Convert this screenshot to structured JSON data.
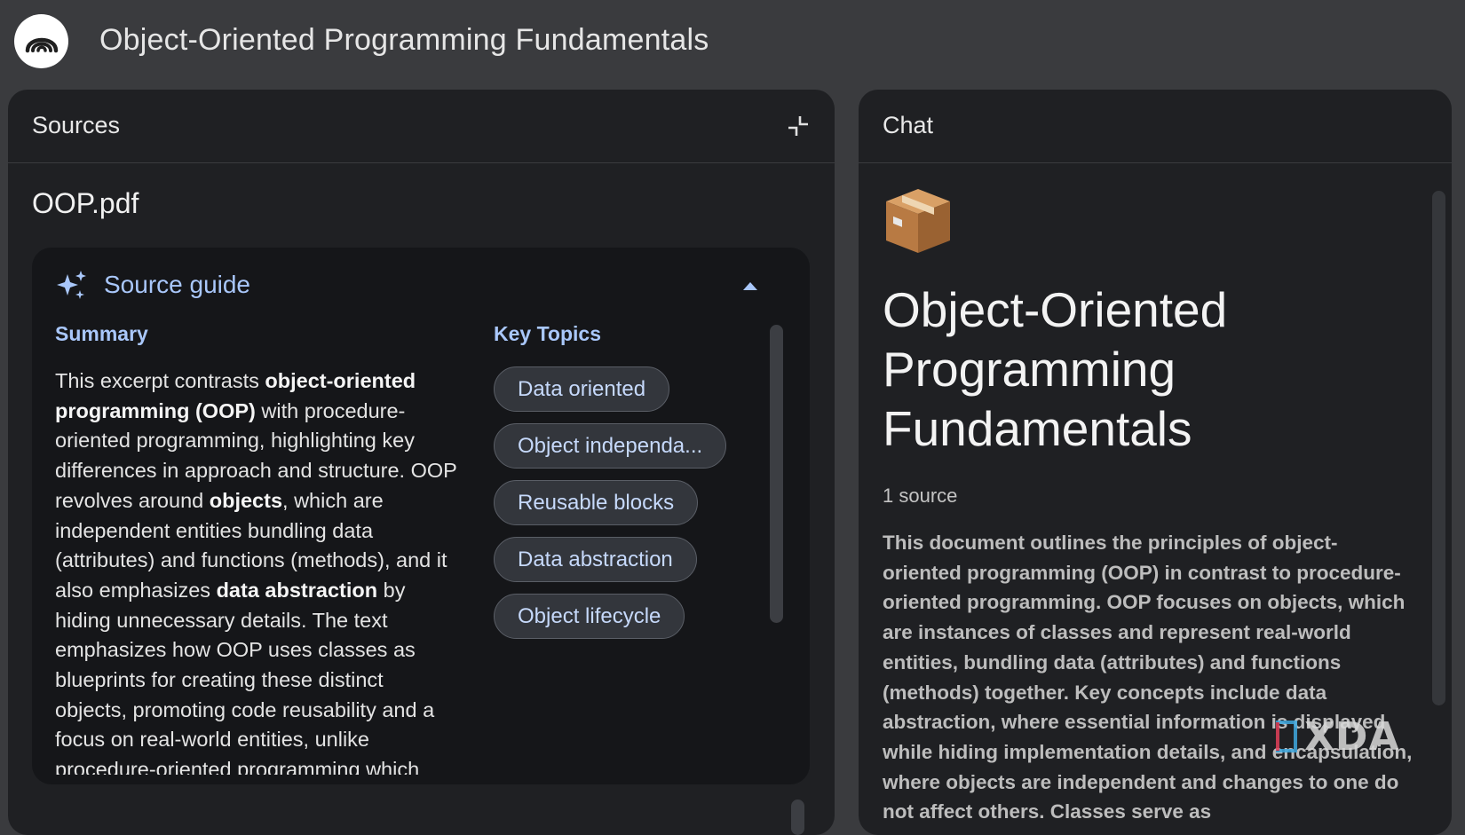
{
  "app": {
    "title": "Object-Oriented Programming Fundamentals",
    "logo_icon": "notebooklm-logo-icon"
  },
  "sources": {
    "panel_title": "Sources",
    "collapse_icon": "collapse-icon",
    "document_title": "OOP.pdf",
    "guide": {
      "label": "Source guide",
      "icon": "sparkle-icon",
      "toggle_icon": "chevron-up-icon",
      "summary_heading": "Summary",
      "summary_parts": {
        "p1": "This excerpt contrasts ",
        "b1": "object-oriented programming (OOP)",
        "p2": " with procedure-oriented programming, highlighting key differences in approach and structure. OOP revolves around ",
        "b2": "objects",
        "p3": ", which are independent entities bundling data (attributes) and functions (methods), and it also emphasizes ",
        "b3": "data abstraction",
        "p4": " by hiding unnecessary details. The text emphasizes how OOP uses classes as blueprints for creating these distinct objects, promoting code reusability and a focus on real-world entities, unlike procedure-oriented programming which"
      },
      "topics_heading": "Key Topics",
      "topics": [
        "Data oriented",
        "Object independa...",
        "Reusable blocks",
        "Data abstraction",
        "Object lifecycle"
      ]
    }
  },
  "chat": {
    "panel_title": "Chat",
    "emoji_icon": "package-box-icon",
    "notebook_title": "Object-Oriented Programming Fundamentals",
    "source_count": "1 source",
    "summary": "This document outlines the principles of object-oriented programming (OOP) in contrast to procedure-oriented programming. OOP focuses on objects, which are instances of classes and represent real-world entities, bundling data (attributes) and functions (methods) together. Key concepts include data abstraction, where essential information is displayed while hiding implementation details, and encapsulation, where objects are independent and changes to one do not affect others. Classes serve as"
  },
  "watermark": {
    "text": "XDA"
  },
  "colors": {
    "background": "#3a3b3e",
    "panel": "#1f2023",
    "card": "#151619",
    "accent": "#a9c7fa",
    "chip_text": "#c6d9fb"
  }
}
